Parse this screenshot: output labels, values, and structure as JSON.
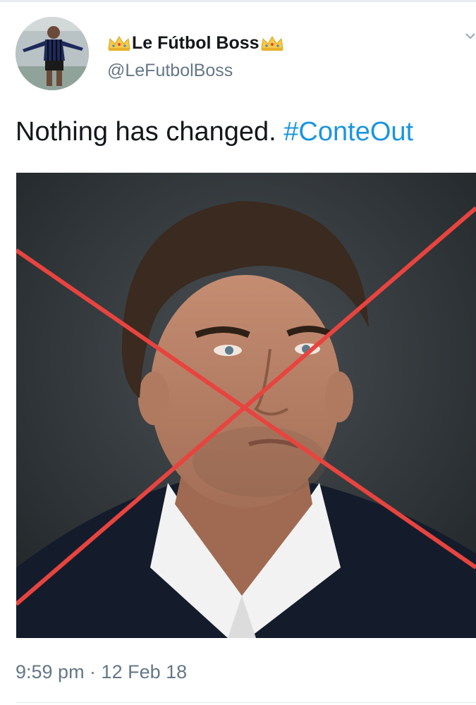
{
  "profile": {
    "display_name": "Le Fútbol Boss",
    "handle": "@LeFutbolBoss",
    "avatar_icon": "footballer-avatar",
    "badge_icon": "crown-emoji"
  },
  "tweet": {
    "text": "Nothing has changed.",
    "hashtag": "#ConteOut",
    "media_icon": "crossed-out-portrait-photo",
    "timestamp": "9:59 pm · 12 Feb 18"
  },
  "colors": {
    "link": "#1b95e0",
    "secondary_text": "#657786",
    "primary_text": "#14171a",
    "cross_mark": "#e8443f"
  }
}
